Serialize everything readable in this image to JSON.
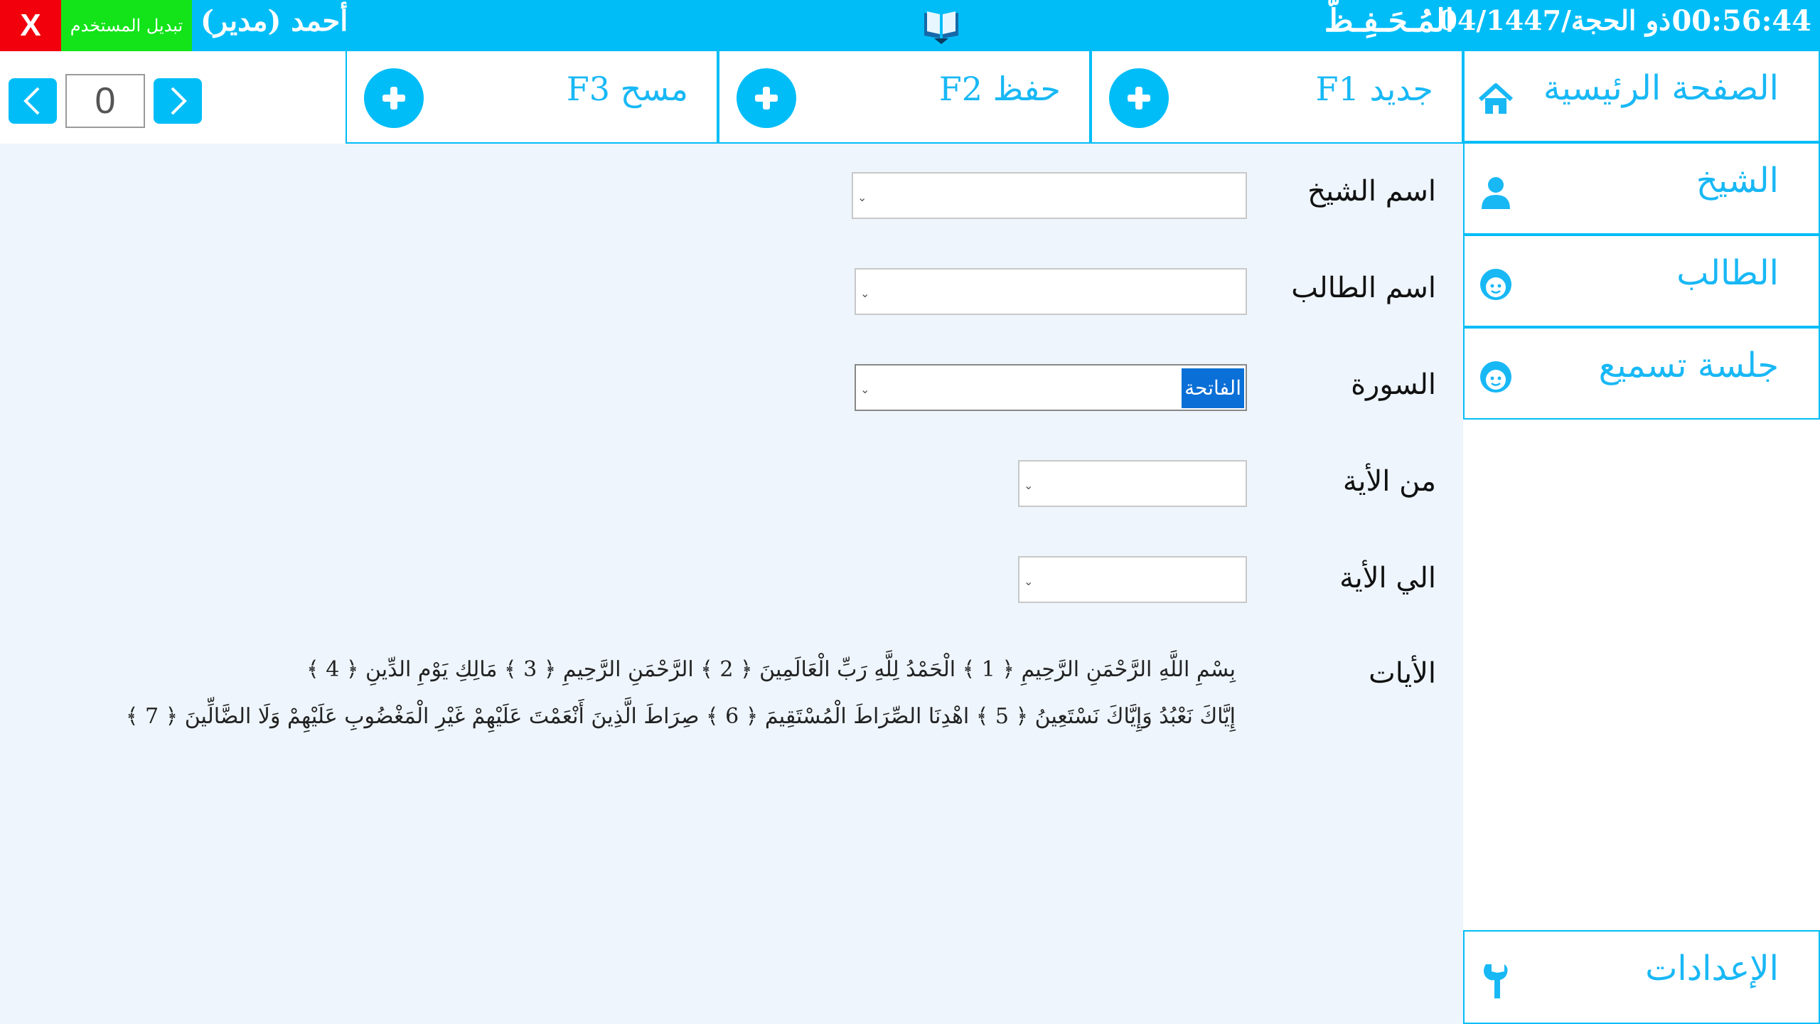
{
  "topbar": {
    "time": "00:56:44",
    "date": "04/ذو الحجة/1447",
    "app_name": "المُـحَـفِـظّ",
    "user": "أحمد (مدير)",
    "switch_user": "تبديل المستخدم",
    "close": "X",
    "logo_icon": "open-book-icon"
  },
  "toolbar": {
    "new": "جديد F1",
    "save": "حفظ F2",
    "clear": "مسح F3"
  },
  "pager": {
    "count": "0"
  },
  "sidebar": {
    "home": "الصفحة الرئيسية",
    "sheikh": "الشيخ",
    "student": "الطالب",
    "session": "جلسة تسميع",
    "settings": "الإعدادات"
  },
  "form": {
    "sheikh_label": "اسم الشيخ",
    "student_label": "اسم الطالب",
    "surah_label": "السورة",
    "surah_value": "الفاتحة",
    "from_label": "من الأية",
    "to_label": "الي الأية",
    "ayat_label": "الأيات",
    "ayat_line1": "بِسْمِ اللَّهِ الرَّحْمَنِ الرَّحِيمِ ﴿ 1 ﴾   الْحَمْدُ لِلَّهِ رَبِّ الْعَالَمِينَ ﴿ 2 ﴾   الرَّحْمَنِ الرَّحِيمِ ﴿ 3 ﴾   مَالِكِ يَوْمِ الدِّينِ ﴿ 4 ﴾",
    "ayat_line2": "إِيَّاكَ نَعْبُدُ وَإِيَّاكَ نَسْتَعِينُ ﴿ 5 ﴾   اهْدِنَا الصِّرَاطَ الْمُسْتَقِيمَ ﴿ 6 ﴾   صِرَاطَ الَّذِينَ أَنْعَمْتَ عَلَيْهِمْ غَيْرِ الْمَغْضُوبِ عَلَيْهِمْ وَلَا الضَّالِّينَ ﴿ 7 ﴾"
  },
  "colors": {
    "accent": "#00bdf7",
    "danger": "#f2000c",
    "success": "#13e41a"
  }
}
